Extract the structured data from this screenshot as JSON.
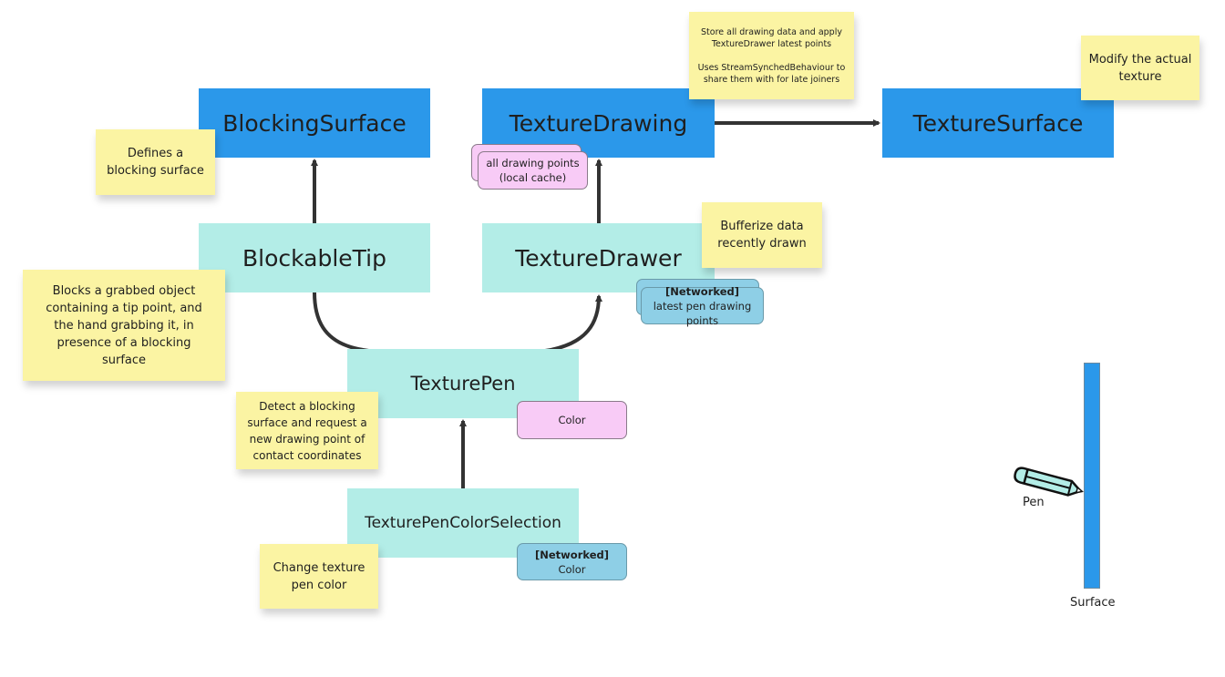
{
  "components": {
    "blocking_surface": "BlockingSurface",
    "texture_drawing": "TextureDrawing",
    "texture_surface": "TextureSurface",
    "blockable_tip": "BlockableTip",
    "texture_drawer": "TextureDrawer",
    "texture_pen": "TexturePen",
    "texture_pen_color_selection": "TexturePenColorSelection"
  },
  "notes": {
    "texture_drawing": "Store all drawing data and apply\nTextureDrawer latest points\n\nUses StreamSynchedBehaviour to\nshare them with for late joiners",
    "texture_surface": "Modify the actual texture",
    "blocking_surface": "Defines a blocking surface",
    "texture_drawer": "Bufferize data recently drawn",
    "blockable_tip": "Blocks a grabbed object containing a tip point, and the hand grabbing it, in presence of a blocking surface",
    "texture_pen": "Detect a blocking surface and request a new drawing point of contact coordinates",
    "color_selection": "Change texture pen color"
  },
  "tags": {
    "local_cache": "all drawing points\n(local cache)",
    "networked_label": "[Networked]",
    "latest_points": "latest pen drawing points",
    "pen_color": "Color",
    "networked_color": "Color"
  },
  "illustration": {
    "pen_label": "Pen",
    "surface_label": "Surface"
  },
  "colors": {
    "component_primary": "#2b98ea",
    "component_secondary": "#b3ede7",
    "sticky": "#fbf4a3",
    "local_tag": "#f8cbf6",
    "networked_tag": "#8ecfe6"
  }
}
